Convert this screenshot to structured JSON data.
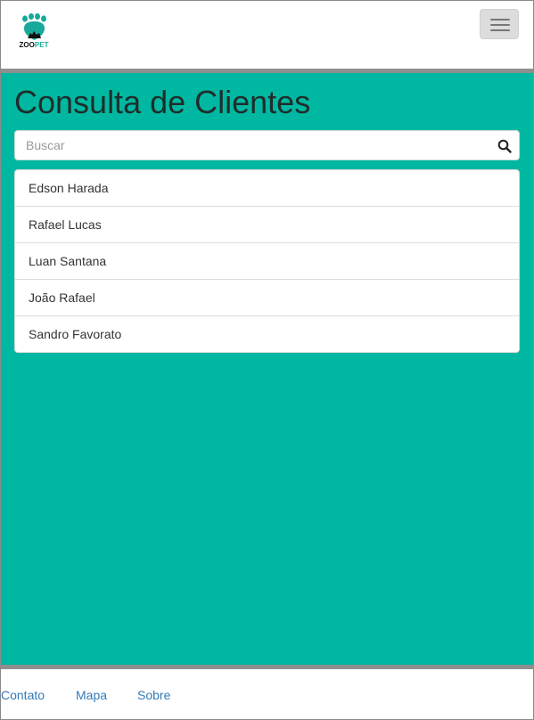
{
  "navbar": {
    "logo": {
      "text_zoo": "ZOO",
      "text_pet": "PET",
      "accent": "#19a99a"
    },
    "menu_icon": "hamburger-icon"
  },
  "main": {
    "background": "#00b8a1",
    "title": "Consulta de Clientes",
    "search": {
      "placeholder": "Buscar",
      "value": "",
      "icon": "search-icon"
    },
    "clients": [
      {
        "name": "Edson Harada"
      },
      {
        "name": "Rafael Lucas"
      },
      {
        "name": "Luan Santana"
      },
      {
        "name": "João Rafael"
      },
      {
        "name": "Sandro Favorato"
      }
    ]
  },
  "footer": {
    "links": [
      {
        "label": "Contato"
      },
      {
        "label": "Mapa"
      },
      {
        "label": "Sobre"
      }
    ],
    "link_color": "#337ab7"
  }
}
